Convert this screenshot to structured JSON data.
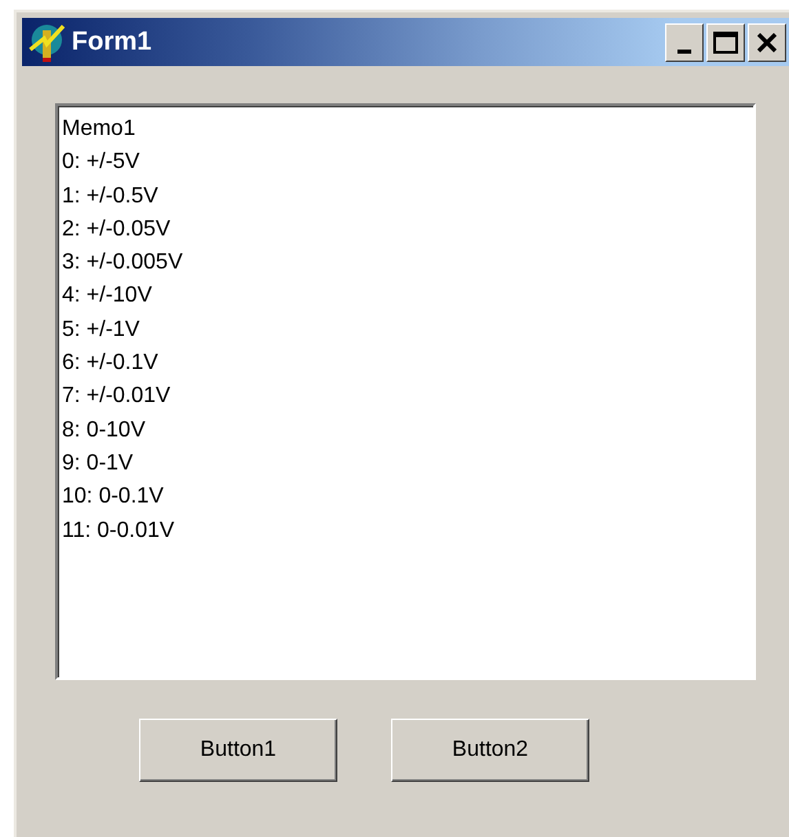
{
  "window": {
    "title": "Form1"
  },
  "memo": {
    "lines": [
      "Memo1",
      "0: +/-5V",
      "1: +/-0.5V",
      "2: +/-0.05V",
      "3: +/-0.005V",
      "4: +/-10V",
      "5: +/-1V",
      "6: +/-0.1V",
      "7: +/-0.01V",
      "8: 0-10V",
      "9: 0-1V",
      "10: 0-0.1V",
      "11: 0-0.01V"
    ]
  },
  "buttons": [
    "Button1",
    "Button2"
  ]
}
